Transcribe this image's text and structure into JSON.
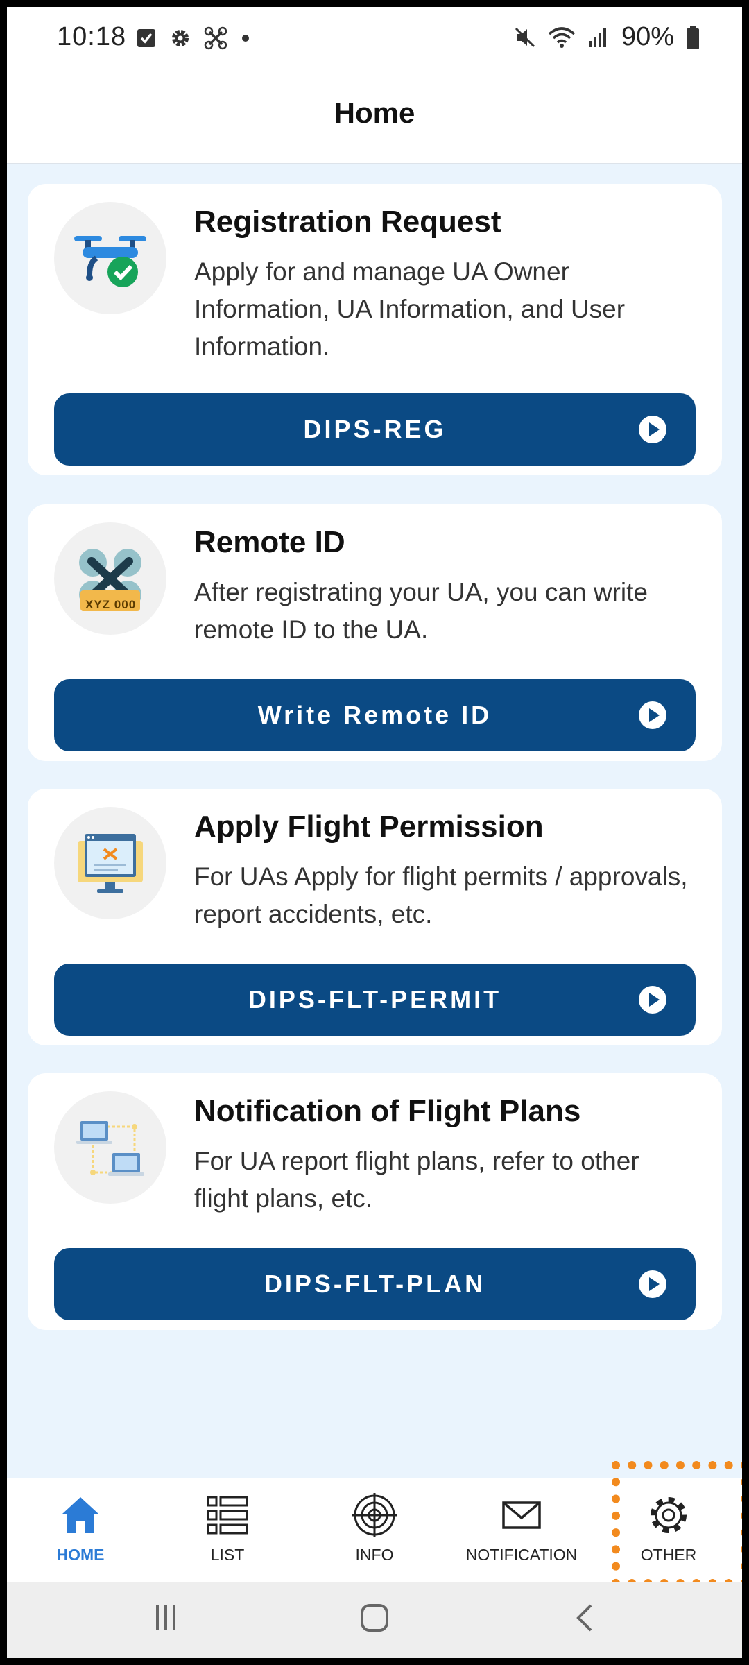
{
  "status_bar": {
    "time": "10:18",
    "battery": "90%",
    "left_icons": [
      "checkbox-icon",
      "gear-icon",
      "drone-icon",
      "dot-icon"
    ],
    "right_icons": [
      "mute-icon",
      "wifi-icon",
      "signal-icon",
      "battery-icon"
    ]
  },
  "header": {
    "title": "Home"
  },
  "cards": [
    {
      "title": "Registration Request",
      "description": "Apply for and manage UA Owner Information, UA Information, and User Information.",
      "button": "DIPS-REG",
      "icon": "drone-check-icon"
    },
    {
      "title": "Remote ID",
      "description": "After registrating your UA, you can write remote ID to the UA.",
      "button": "Write Remote ID",
      "icon": "drone-remote-id-icon",
      "icon_plate_text": "XYZ 000"
    },
    {
      "title": "Apply Flight Permission",
      "description": "For UAs Apply for flight permits / approvals, report accidents, etc.",
      "button": "DIPS-FLT-PERMIT",
      "icon": "monitor-drone-icon"
    },
    {
      "title": "Notification of Flight Plans",
      "description": "For UA report flight plans, refer to other flight plans, etc.",
      "button": "DIPS-FLT-PLAN",
      "icon": "network-laptops-icon"
    }
  ],
  "bottom_nav": [
    {
      "label": "HOME",
      "icon": "home-icon",
      "active": true
    },
    {
      "label": "LIST",
      "icon": "list-icon",
      "active": false
    },
    {
      "label": "INFO",
      "icon": "target-icon",
      "active": false
    },
    {
      "label": "NOTIFICATION",
      "icon": "mail-icon",
      "active": false
    },
    {
      "label": "OTHER",
      "icon": "gear-icon",
      "active": false
    }
  ],
  "colors": {
    "primary_button": "#0b4a84",
    "active_nav": "#2b7bd6",
    "background": "#eaf4fd",
    "highlight": "#f28a1e"
  }
}
